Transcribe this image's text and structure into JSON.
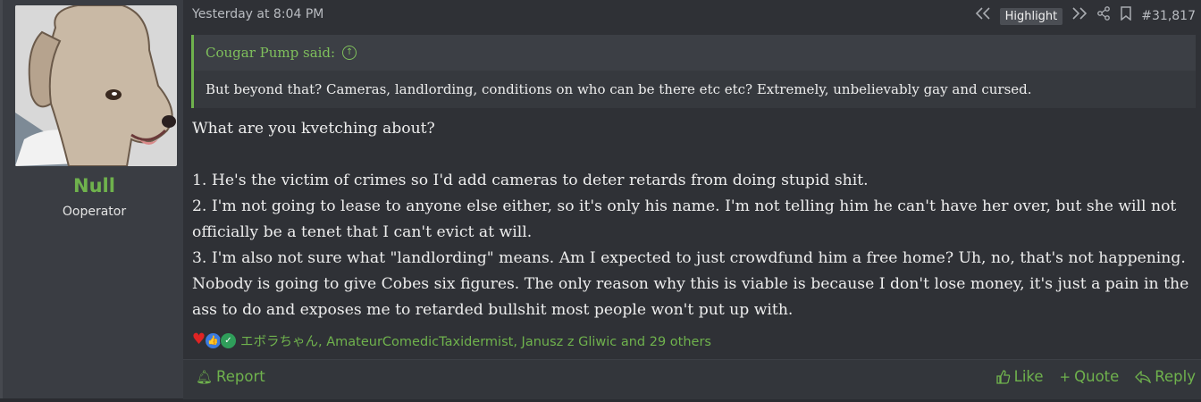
{
  "user": {
    "name": "Null",
    "title": "Ooperator"
  },
  "header": {
    "timestamp": "Yesterday at 8:04 PM",
    "highlight_label": "Highlight",
    "post_number": "#31,817",
    "icons": [
      "rewind-icon",
      "fast-forward-icon",
      "share-icon",
      "bookmark-icon"
    ]
  },
  "quote": {
    "author": "Cougar Pump said:",
    "text": "But beyond that? Cameras, landlording, conditions on who can be there etc etc? Extremely, unbelievably gay and cursed."
  },
  "body": {
    "line1": "What are you kvetching about?",
    "item1": "1. He's the victim of crimes so I'd add cameras to deter retards from doing stupid shit.",
    "item2": "2. I'm not going to lease to anyone else either, so it's only his name. I'm not telling him he can't have her over, but she will not officially be a tenet that I can't evict at will.",
    "item3": "3. I'm also not sure what \"landlording\" means. Am I expected to just crowdfund him a free home? Uh, no, that's not happening. Nobody is going to give Cobes six figures. The only reason why this is viable is because I don't lose money, it's just a pain in the ass to do and exposes me to retarded bullshit most people won't put up with."
  },
  "reactions": {
    "text": "エボラちゃん, AmateurComedicTaxidermist, Janusz z Gliwic and 29 others",
    "icons": [
      "heart-icon",
      "like-icon",
      "check-icon"
    ]
  },
  "footer": {
    "report": "Report",
    "like": "Like",
    "quote": "Quote",
    "reply": "Reply"
  },
  "colors": {
    "accent": "#6fb24d",
    "background": "#2f3136",
    "userpane": "#3a3d43"
  }
}
